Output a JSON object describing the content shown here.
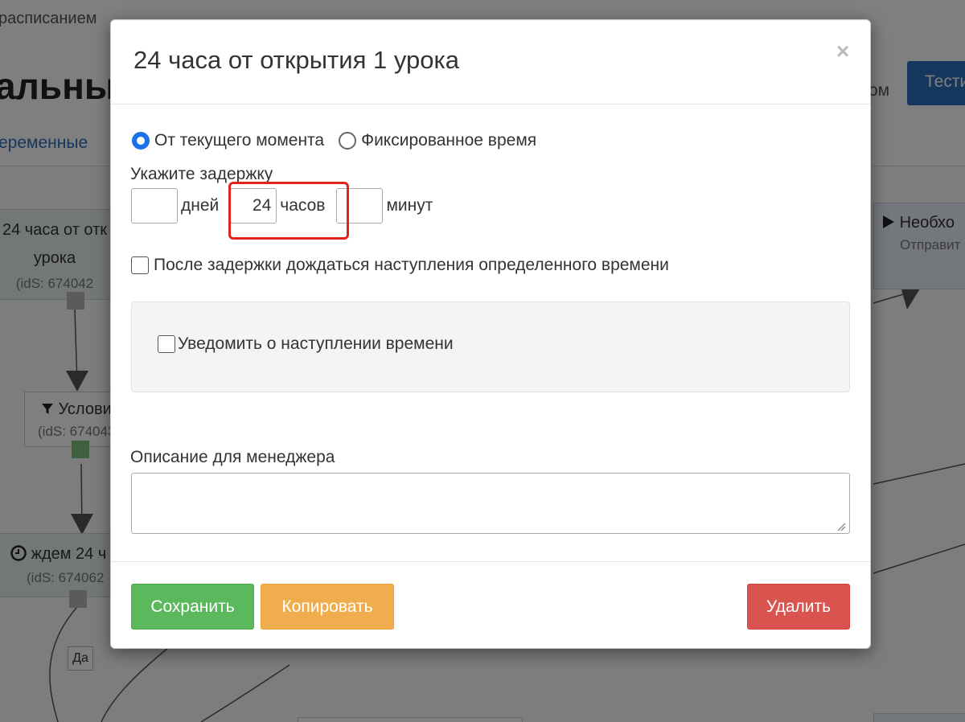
{
  "background": {
    "breadcrumb": "расписанием",
    "page_title": "альны",
    "tab_label": "еременные",
    "right_word": "ом",
    "test_button_label": "Тести",
    "nodes": [
      {
        "title_line1": "24 часа от отк",
        "title_line2": "урока",
        "ids": "(idS: 674042"
      },
      {
        "title": "Услови",
        "ids": "(idS: 674043"
      },
      {
        "title": "ждем 24 ч",
        "ids": "(idS: 674062"
      },
      {
        "title": "Необхо",
        "subtitle": "Отправит"
      }
    ],
    "yes_tag": "Да"
  },
  "modal": {
    "title": "24 часа от открытия 1 урока",
    "close_symbol": "×",
    "mode_options": [
      {
        "label": "От текущего момента",
        "selected": true
      },
      {
        "label": "Фиксированное время",
        "selected": false
      }
    ],
    "delay_label": "Укажите задержку",
    "delay": {
      "days": {
        "value": "",
        "unit": "дней"
      },
      "hours": {
        "value": "24",
        "unit": "часов"
      },
      "minutes": {
        "value": "",
        "unit": "минут"
      }
    },
    "wait_time_checkbox": {
      "label": "После задержки дождаться наступления определенного времени",
      "checked": false
    },
    "notify_checkbox": {
      "label": "Уведомить о наступлении времени",
      "checked": false
    },
    "description_label": "Описание для менеджера",
    "description_value": "",
    "buttons": {
      "save": "Сохранить",
      "copy": "Копировать",
      "delete": "Удалить"
    }
  },
  "colors": {
    "save": "#5cb85c",
    "copy": "#f0ad4e",
    "delete": "#d9534f",
    "radio_selected": "#1a73e8",
    "highlight": "#e0231f"
  }
}
